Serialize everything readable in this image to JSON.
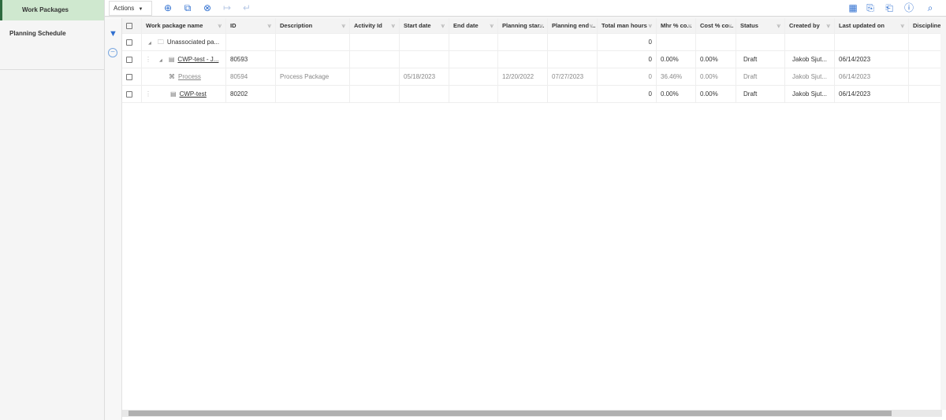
{
  "sidebar": {
    "items": [
      {
        "label": "Work Packages",
        "active": true
      },
      {
        "label": "Planning Schedule",
        "active": false
      }
    ]
  },
  "toolbar": {
    "actions_label": "Actions",
    "actions_caret": "▼"
  },
  "columns": [
    "",
    "Work package name",
    "ID",
    "Description",
    "Activity Id",
    "Start date",
    "End date",
    "Planning star...",
    "Planning end ...",
    "Total man hours",
    "Mhr % co...",
    "Cost % co...",
    "Status",
    "Created by",
    "Last updated on",
    "Discipline"
  ],
  "rows": [
    {
      "name": "Unassociated pa...",
      "icon": "folder-icon",
      "id": "",
      "description": "",
      "activity": "",
      "start": "",
      "end": "",
      "pstart": "",
      "pend": "",
      "hours": "0",
      "mhr": "",
      "cost": "",
      "status": "",
      "created": "",
      "updated": "",
      "discipline": "",
      "indent": 0,
      "dim": false,
      "link": false,
      "expander": true,
      "handle": false
    },
    {
      "name": "CWP-test - J...",
      "icon": "document-icon",
      "id": "80593",
      "description": "",
      "activity": "",
      "start": "",
      "end": "",
      "pstart": "",
      "pend": "",
      "hours": "0",
      "mhr": "0.00%",
      "cost": "0.00%",
      "status": "Draft",
      "created": "Jakob Sjut...",
      "updated": "06/14/2023",
      "discipline": "",
      "indent": 1,
      "dim": false,
      "link": true,
      "expander": true,
      "handle": true
    },
    {
      "name": "Process",
      "icon": "process-icon",
      "id": "80594",
      "description": "Process Package",
      "activity": "",
      "start": "05/18/2023",
      "end": "",
      "pstart": "12/20/2022",
      "pend": "07/27/2023",
      "hours": "0",
      "mhr": "36.46%",
      "cost": "0.00%",
      "status": "Draft",
      "created": "Jakob Sjut...",
      "updated": "06/14/2023",
      "discipline": "",
      "indent": 2,
      "dim": true,
      "link": true,
      "expander": false,
      "handle": false
    },
    {
      "name": "CWP-test",
      "icon": "document-icon",
      "id": "80202",
      "description": "",
      "activity": "",
      "start": "",
      "end": "",
      "pstart": "",
      "pend": "",
      "hours": "0",
      "mhr": "0.00%",
      "cost": "0.00%",
      "status": "Draft",
      "created": "Jakob Sjut...",
      "updated": "06/14/2023",
      "discipline": "",
      "indent": 1,
      "dim": false,
      "link": true,
      "expander": false,
      "handle": true
    }
  ]
}
